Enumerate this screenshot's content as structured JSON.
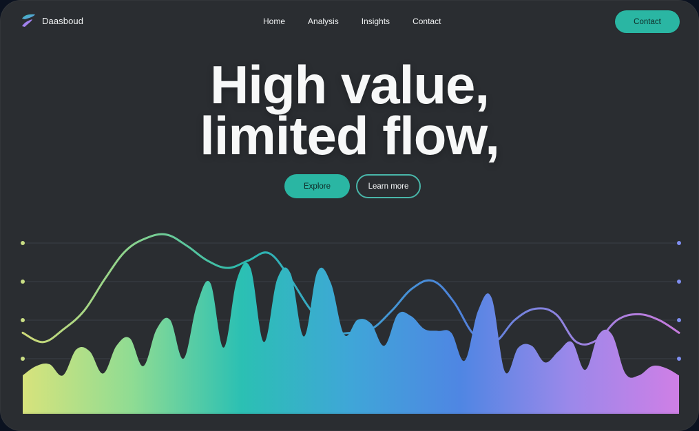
{
  "brand": {
    "name": "Daasboud"
  },
  "nav": {
    "items": [
      "Home",
      "Analysis",
      "Insights",
      "Contact"
    ]
  },
  "header": {
    "contact_label": "Contact"
  },
  "hero": {
    "title_line1": "High value,",
    "title_line2": "limited flow,",
    "primary_cta": "Explore",
    "secondary_cta": "Learn more"
  },
  "colors": {
    "accent": "#2ab6a3",
    "background": "#2a2d31",
    "gradient": [
      "#d7e37c",
      "#8fdc93",
      "#2bc0b3",
      "#3fa6d8",
      "#4f86e3",
      "#9b88ea",
      "#cf7fe6"
    ]
  },
  "chart_data": {
    "type": "area",
    "title": "",
    "xlabel": "",
    "ylabel": "",
    "grid": true,
    "series": [
      {
        "values": [
          0.2,
          0.25,
          0.26,
          0.2,
          0.34,
          0.33,
          0.21,
          0.36,
          0.4,
          0.25,
          0.45,
          0.5,
          0.29,
          0.58,
          0.7,
          0.35,
          0.72,
          0.78,
          0.38,
          0.72,
          0.75,
          0.41,
          0.76,
          0.7,
          0.42,
          0.5,
          0.48,
          0.36,
          0.53,
          0.52,
          0.45,
          0.44,
          0.43,
          0.28,
          0.55,
          0.62,
          0.22,
          0.35,
          0.36,
          0.27,
          0.33,
          0.38,
          0.23,
          0.42,
          0.42,
          0.21,
          0.2,
          0.25,
          0.24,
          0.2
        ]
      },
      {
        "values": [
          0.43,
          0.38,
          0.45,
          0.55,
          0.72,
          0.87,
          0.94,
          0.96,
          0.9,
          0.82,
          0.78,
          0.82,
          0.86,
          0.73,
          0.56,
          0.44,
          0.43,
          0.45,
          0.55,
          0.67,
          0.71,
          0.6,
          0.42,
          0.38,
          0.5,
          0.56,
          0.53,
          0.38,
          0.39,
          0.5,
          0.53,
          0.5,
          0.43
        ]
      }
    ]
  }
}
